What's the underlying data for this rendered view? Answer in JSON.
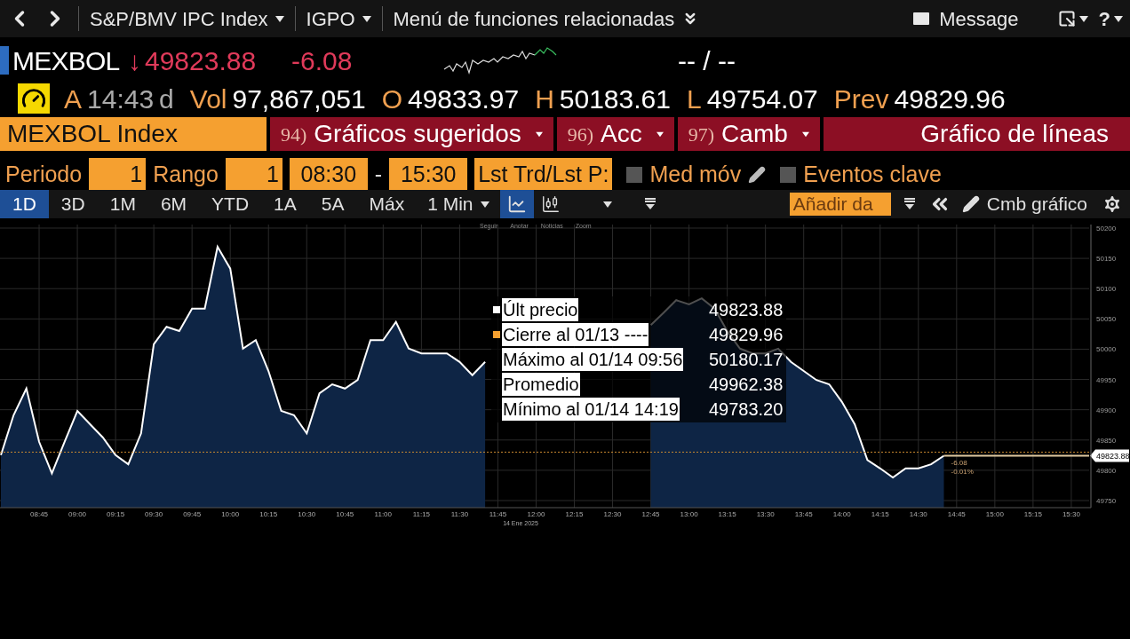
{
  "toolbar": {
    "security": "S&P/BMV IPC Index",
    "source": "IGPO",
    "menu": "Menú de funciones relacionadas",
    "message": "Message",
    "help": "?"
  },
  "quote": {
    "ticker": "MEXBOL",
    "arrow": "↓",
    "price": "49823.88",
    "change": "-6.08",
    "bid_ask": "-- / --"
  },
  "stats": {
    "market_status": "A",
    "time": "14:43",
    "delay": "d",
    "fields": [
      {
        "label": "Vol",
        "value": "97,867,051"
      },
      {
        "label": "O",
        "value": "49833.97"
      },
      {
        "label": "H",
        "value": "50183.61"
      },
      {
        "label": "L",
        "value": "49754.07"
      },
      {
        "label": "Prev",
        "value": "49829.96"
      }
    ]
  },
  "command": {
    "value": "MEXBOL Index",
    "tabs": [
      {
        "number": "94)",
        "label": "Gráficos sugeridos",
        "dropdown": true
      },
      {
        "number": "96)",
        "label": "Acc",
        "dropdown": true
      },
      {
        "number": "97)",
        "label": "Camb",
        "dropdown": true
      },
      {
        "label": "Gráfico de líneas",
        "dropdown": false
      }
    ]
  },
  "settings": {
    "period_label": "Periodo",
    "period": "1",
    "range_label": "Rango",
    "range": "1",
    "start": "08:30",
    "separator": "-",
    "end": "15:30",
    "price_type": "Lst Trd/Lst P:",
    "toggles": [
      {
        "label": "Med móv",
        "checked": false,
        "editable": true
      },
      {
        "label": "Eventos clave",
        "checked": false,
        "editable": false
      }
    ]
  },
  "ranges": [
    {
      "label": "1D",
      "selected": true
    },
    {
      "label": "3D",
      "selected": false
    },
    {
      "label": "1M",
      "selected": false
    },
    {
      "label": "6M",
      "selected": false
    },
    {
      "label": "YTD",
      "selected": false
    },
    {
      "label": "1A",
      "selected": false
    },
    {
      "label": "5A",
      "selected": false
    },
    {
      "label": "Máx",
      "selected": false
    }
  ],
  "interval": "1 Min",
  "chart_types": [
    {
      "kind": "line",
      "selected": true
    },
    {
      "kind": "bar",
      "selected": false
    }
  ],
  "add_data": "Añadir da",
  "edit_chart": "Cmb gráfico",
  "chart_tools": [
    "Seguir",
    "Anotar",
    "Noticias",
    "Zoom"
  ],
  "legend": [
    {
      "label": "Últ precio",
      "value": "49823.88",
      "color": "#ffffff"
    },
    {
      "label": "Cierre al 01/13 ----",
      "value": "49829.96",
      "color": "#f5a030"
    },
    {
      "label": "Máximo al 01/14 09:56",
      "value": "50180.17"
    },
    {
      "label": "Promedio",
      "value": "49962.38"
    },
    {
      "label": "Mínimo al 01/14 14:19",
      "value": "49783.20"
    }
  ],
  "chart": {
    "chart_data": {
      "type": "area",
      "xlabel": "14 Ene 2025",
      "grid": true,
      "x": [
        510,
        515,
        520,
        525,
        530,
        535,
        540,
        545,
        550,
        555,
        560,
        565,
        570,
        575,
        580,
        585,
        590,
        595,
        600,
        605,
        610,
        615,
        620,
        625,
        630,
        635,
        640,
        645,
        650,
        655,
        660,
        665,
        670,
        675,
        680,
        685,
        690,
        695,
        700,
        705,
        710,
        715,
        720,
        725,
        730,
        735,
        740,
        745,
        750,
        755,
        760,
        765,
        770,
        775,
        780,
        785,
        790,
        795,
        800,
        805,
        810,
        815,
        820,
        825,
        830,
        835,
        840,
        845,
        850,
        855,
        860,
        865,
        870,
        875,
        880
      ],
      "series": [
        {
          "color": "#ffffff",
          "values": [
            49825,
            49891,
            49935,
            49847,
            49795,
            49847,
            49898,
            49876,
            49854,
            49825,
            49810,
            49861,
            50008,
            50037,
            50030,
            50067,
            50067,
            50169,
            50133,
            50001,
            50015,
            49964,
            49898,
            49891,
            49861,
            49927,
            49942,
            49935,
            49949,
            50015,
            50015,
            50045,
            50001,
            49993,
            49993,
            49993,
            49979,
            49957,
            49979,
            null,
            null,
            null,
            null,
            null,
            null,
            null,
            null,
            null,
            null,
            null,
            null,
            50040,
            50060,
            50081,
            50074,
            50084,
            50067,
            50030,
            50001,
            49993,
            49993,
            50001,
            49979,
            49964,
            49949,
            49942,
            49913,
            49876,
            49817,
            49803,
            49788,
            49803,
            49803,
            49810,
            49824
          ]
        }
      ],
      "xlim": [
        510,
        937
      ],
      "ylim": [
        49750,
        50200
      ],
      "xticks": [
        {
          "value": 525,
          "label": "08:45"
        },
        {
          "value": 540,
          "label": "09:00"
        },
        {
          "value": 555,
          "label": "09:15"
        },
        {
          "value": 570,
          "label": "09:30"
        },
        {
          "value": 585,
          "label": "09:45"
        },
        {
          "value": 600,
          "label": "10:00"
        },
        {
          "value": 615,
          "label": "10:15"
        },
        {
          "value": 630,
          "label": "10:30"
        },
        {
          "value": 645,
          "label": "10:45"
        },
        {
          "value": 660,
          "label": "11:00"
        },
        {
          "value": 675,
          "label": "11:15"
        },
        {
          "value": 690,
          "label": "11:30"
        },
        {
          "value": 705,
          "label": "11:45"
        },
        {
          "value": 720,
          "label": "12:00"
        },
        {
          "value": 735,
          "label": "12:15"
        },
        {
          "value": 750,
          "label": "12:30"
        },
        {
          "value": 765,
          "label": "12:45"
        },
        {
          "value": 780,
          "label": "13:00"
        },
        {
          "value": 795,
          "label": "13:15"
        },
        {
          "value": 810,
          "label": "13:30"
        },
        {
          "value": 825,
          "label": "13:45"
        },
        {
          "value": 840,
          "label": "14:00"
        },
        {
          "value": 855,
          "label": "14:15"
        },
        {
          "value": 870,
          "label": "14:30"
        },
        {
          "value": 885,
          "label": "14:45"
        },
        {
          "value": 900,
          "label": "15:00"
        },
        {
          "value": 915,
          "label": "15:15"
        },
        {
          "value": 930,
          "label": "15:30"
        }
      ],
      "yticks": [
        49750,
        49800,
        49850,
        49900,
        49950,
        50000,
        50050,
        50100,
        50150,
        50200
      ],
      "ref_lines": [
        {
          "axis": "y",
          "value": 49829.96,
          "color": "#c8882f"
        },
        {
          "axis": "y",
          "value": 49823.88,
          "color": "#e0c9a0",
          "label": "49823.88"
        }
      ],
      "annotations": [
        "-6.08",
        "-0.01%"
      ]
    }
  }
}
